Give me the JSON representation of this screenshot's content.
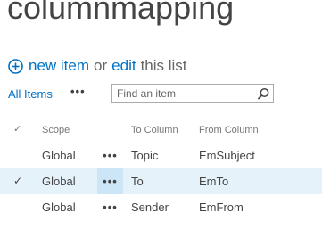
{
  "page": {
    "title": "columnmapping"
  },
  "actions": {
    "new_item_label": "new item",
    "or_text": "or",
    "edit_label": "edit",
    "this_list_text": "this list"
  },
  "views": {
    "current_view": "All Items",
    "more_label": "•••"
  },
  "search": {
    "placeholder": "Find an item",
    "value": ""
  },
  "grid": {
    "columns": {
      "check": "✓",
      "scope": "Scope",
      "to_column": "To Column",
      "from_column": "From Column"
    },
    "rows": [
      {
        "selected": "",
        "scope": "Global",
        "menu": "•••",
        "to_column": "Topic",
        "from_column": "EmSubject"
      },
      {
        "selected": "✓",
        "scope": "Global",
        "menu": "•••",
        "to_column": "To",
        "from_column": "EmTo"
      },
      {
        "selected": "",
        "scope": "Global",
        "menu": "•••",
        "to_column": "Sender",
        "from_column": "EmFrom"
      }
    ]
  },
  "colors": {
    "accent": "#0072c6",
    "selected_row": "#e6f2fa",
    "text": "#444444"
  }
}
